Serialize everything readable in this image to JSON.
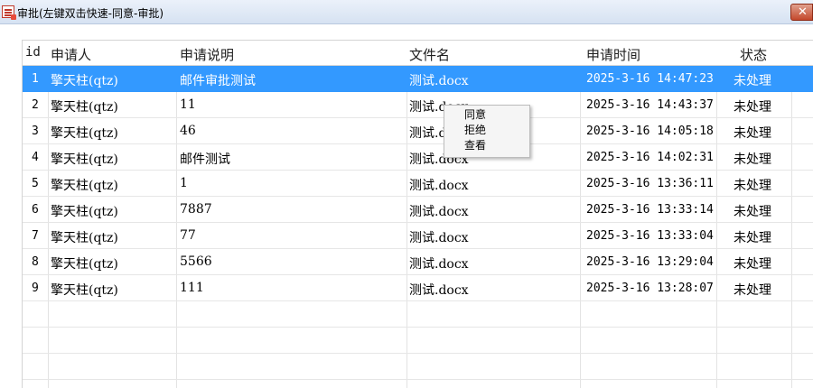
{
  "window": {
    "title": "审批(左键双击快速-同意-审批)",
    "close_symbol": "✕"
  },
  "table": {
    "columns": [
      "id",
      "申请人",
      "申请说明",
      "文件名",
      "申请时间",
      "状态"
    ],
    "rows": [
      {
        "id": "1",
        "applicant": "擎天柱(qtz)",
        "description": "邮件审批测试",
        "file": "测试.docx",
        "time": "2025-3-16 14:47:23",
        "status": "未处理"
      },
      {
        "id": "2",
        "applicant": "擎天柱(qtz)",
        "description": "11",
        "file": "测试.docx",
        "time": "2025-3-16 14:43:37",
        "status": "未处理"
      },
      {
        "id": "3",
        "applicant": "擎天柱(qtz)",
        "description": "46",
        "file": "测试.docx",
        "time": "2025-3-16 14:05:18",
        "status": "未处理"
      },
      {
        "id": "4",
        "applicant": "擎天柱(qtz)",
        "description": "邮件测试",
        "file": "测试.docx",
        "time": "2025-3-16 14:02:31",
        "status": "未处理"
      },
      {
        "id": "5",
        "applicant": "擎天柱(qtz)",
        "description": "1",
        "file": "测试.docx",
        "time": "2025-3-16 13:36:11",
        "status": "未处理"
      },
      {
        "id": "6",
        "applicant": "擎天柱(qtz)",
        "description": "7887",
        "file": "测试.docx",
        "time": "2025-3-16 13:33:14",
        "status": "未处理"
      },
      {
        "id": "7",
        "applicant": "擎天柱(qtz)",
        "description": "77",
        "file": "测试.docx",
        "time": "2025-3-16 13:33:04",
        "status": "未处理"
      },
      {
        "id": "8",
        "applicant": "擎天柱(qtz)",
        "description": "5566",
        "file": "测试.docx",
        "time": "2025-3-16 13:29:04",
        "status": "未处理"
      },
      {
        "id": "9",
        "applicant": "擎天柱(qtz)",
        "description": "111",
        "file": "测试.docx",
        "time": "2025-3-16 13:28:07",
        "status": "未处理"
      }
    ]
  },
  "context_menu": {
    "items": [
      "同意",
      "拒绝",
      "查看"
    ]
  },
  "colors": {
    "selection": "#3399ff",
    "title_bar": "#dfe8f5",
    "close_button": "#c4482b"
  },
  "icons": {
    "app": "approval-list-icon",
    "close": "close-icon"
  }
}
